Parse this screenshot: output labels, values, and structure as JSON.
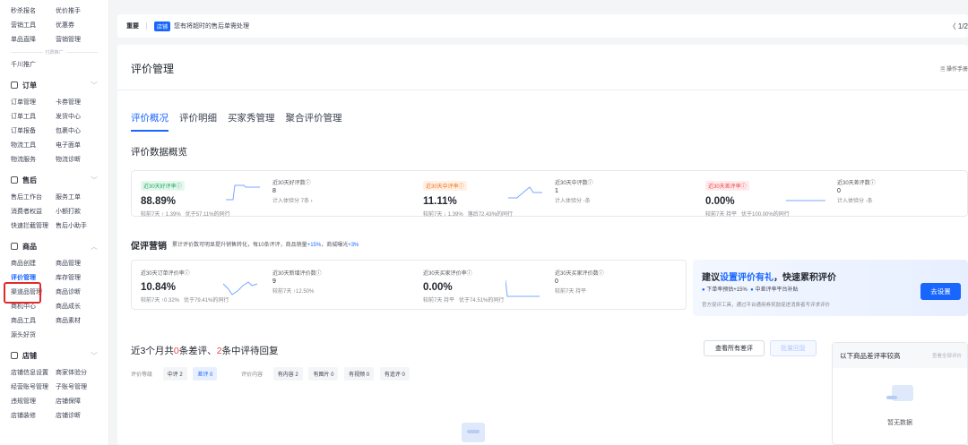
{
  "sidebar": {
    "rows_top": [
      [
        "秒杀报名",
        "优价推手"
      ],
      [
        "营销工具",
        "优惠券"
      ],
      [
        "单品直降",
        "营销管理"
      ]
    ],
    "divider": "付费推广",
    "qianchuan": "千川推广",
    "groups": [
      {
        "title": "订单",
        "rows": [
          [
            "订单管理",
            "卡券管理"
          ],
          [
            "订单工具",
            "发货中心"
          ],
          [
            "订单报备",
            "包裹中心"
          ],
          [
            "物流工具",
            "电子面单"
          ],
          [
            "物流服务",
            "物流诊断"
          ]
        ]
      },
      {
        "title": "售后",
        "rows": [
          [
            "售后工作台",
            "服务工单"
          ],
          [
            "消费者权益",
            "小额打款"
          ],
          [
            "快速拦截管理",
            "售后小助手"
          ]
        ]
      },
      {
        "title": "商品",
        "rows": [
          [
            "商品创建",
            "商品管理"
          ],
          [
            "评价管理",
            "库存管理"
          ],
          [
            "渠道品管理",
            "商品诊断"
          ],
          [
            "商机中心",
            "商品成长"
          ],
          [
            "商品工具",
            "商品素材"
          ],
          [
            "源头好货",
            ""
          ]
        ]
      },
      {
        "title": "店铺",
        "rows": [
          [
            "店铺信息设置",
            "商家体验分"
          ],
          [
            "经营账号管理",
            "子账号管理"
          ],
          [
            "违规管理",
            "店铺保障"
          ],
          [
            "店铺装修",
            "店铺诊断"
          ]
        ]
      }
    ]
  },
  "topbar": {
    "important": "重要",
    "tag": "店铺",
    "message": "您有将超时的售后单需处理",
    "page": "〈  1/2"
  },
  "page": {
    "title": "评价管理",
    "help": "🗎 操作手册"
  },
  "tabs": [
    "评价概况",
    "评价明细",
    "买家秀管理",
    "聚合评价管理"
  ],
  "overview": {
    "title": "评价数据概览",
    "stats": [
      {
        "badge": "近30天好评率ⓘ",
        "value": "88.89%",
        "week": "较前7天 ↑ 1.39%",
        "beat": "优于57.11%的同行",
        "color": "green"
      },
      {
        "label": "近30天好评数ⓘ",
        "value": "8",
        "sub": "计入体验分 7条 ›"
      },
      {
        "badge": "近30天中评率ⓘ",
        "value": "11.11%",
        "week": "较前7天 ↓ 1.39%",
        "beat": "落后72.43%的同行",
        "color": "orange"
      },
      {
        "label": "近30天中评数ⓘ",
        "value": "1",
        "sub": "计入体验分 -条"
      },
      {
        "badge": "近30天差评率ⓘ",
        "value": "0.00%",
        "week": "较前7天 持平",
        "beat": "优于100.00%的同行",
        "color": "red"
      },
      {
        "label": "近30天差评数ⓘ",
        "value": "0",
        "sub": "计入体验分 -条"
      }
    ]
  },
  "promo": {
    "title": "促评营销",
    "subtitle_pre": "累计评价数可明显提升销售转化，每10条评评，商品销量",
    "subtitle_v1": "+15%",
    "subtitle_mid": "，商城曝光",
    "subtitle_v2": "+3%",
    "stats": [
      {
        "label": "近30天订单评价率ⓘ",
        "value": "10.84%",
        "week": "较前7天 ↑0.32%",
        "beat": "优于79.41%的同行"
      },
      {
        "label": "近30天新增评价数ⓘ",
        "value": "9",
        "sub": "较前7天 ↑12.50%"
      },
      {
        "label": "近30天买家评价率ⓘ",
        "value": "0.00%",
        "week": "较前7天 持平",
        "beat": "优于74.51%的同行"
      },
      {
        "label": "近30天买家评价数ⓘ",
        "value": "0",
        "sub": "较前7天 持平"
      }
    ],
    "suggest": {
      "t1": "建议",
      "t2": "设置评价有礼",
      "t3": "，快速累积评价",
      "check1": "下单率预估+15%",
      "check2": "中差评率平台补贴",
      "desc": "官方促评工具，通过平台通用券奖励促进消费者写评求评价",
      "button": "去设置"
    }
  },
  "recent": {
    "t1": "近3个月共",
    "n1": "0",
    "t2": "条差评、",
    "n2": "2",
    "t3": "条中评待回复",
    "btn_all": "查看所有差评",
    "btn_batch": "批量回复",
    "level_label": "评价等级",
    "chip_mid": "中评 2",
    "chip_bad": "差评 0",
    "content_label": "评价内容",
    "chips": [
      "有内容 2",
      "有图片 0",
      "有视频 0",
      "有追评 0"
    ]
  },
  "rank": {
    "title": "以下商品差评率较高",
    "link": "查看全部评价",
    "empty": "暂无数据"
  },
  "colors": {
    "accent": "#1966ff",
    "red": "#e22a2a"
  }
}
